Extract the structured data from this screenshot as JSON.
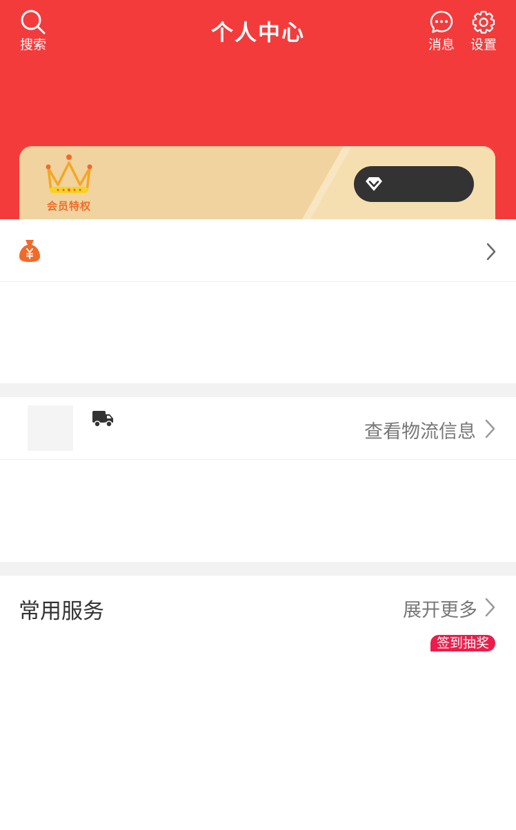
{
  "header": {
    "title": "个人中心",
    "search_label": "搜索",
    "messages_label": "消息",
    "settings_label": "设置",
    "background_color": "#f43b3c",
    "icons": [
      "search-icon",
      "chat-bubble-icon",
      "gear-icon"
    ]
  },
  "vip_card": {
    "label": "会员特权",
    "card_color": "#f0d39e",
    "button_color": "#333333",
    "icons": [
      "crown-icon",
      "diamond-icon"
    ]
  },
  "wallet_row": {
    "icons": [
      "money-bag-icon",
      "chevron-right-icon"
    ]
  },
  "logistics": {
    "link_label": "查看物流信息",
    "icons": [
      "truck-icon",
      "chevron-right-icon"
    ]
  },
  "services": {
    "title": "常用服务",
    "more_label": "展开更多",
    "badge": "签到抽奖",
    "badge_color": "#ec1d4b"
  }
}
